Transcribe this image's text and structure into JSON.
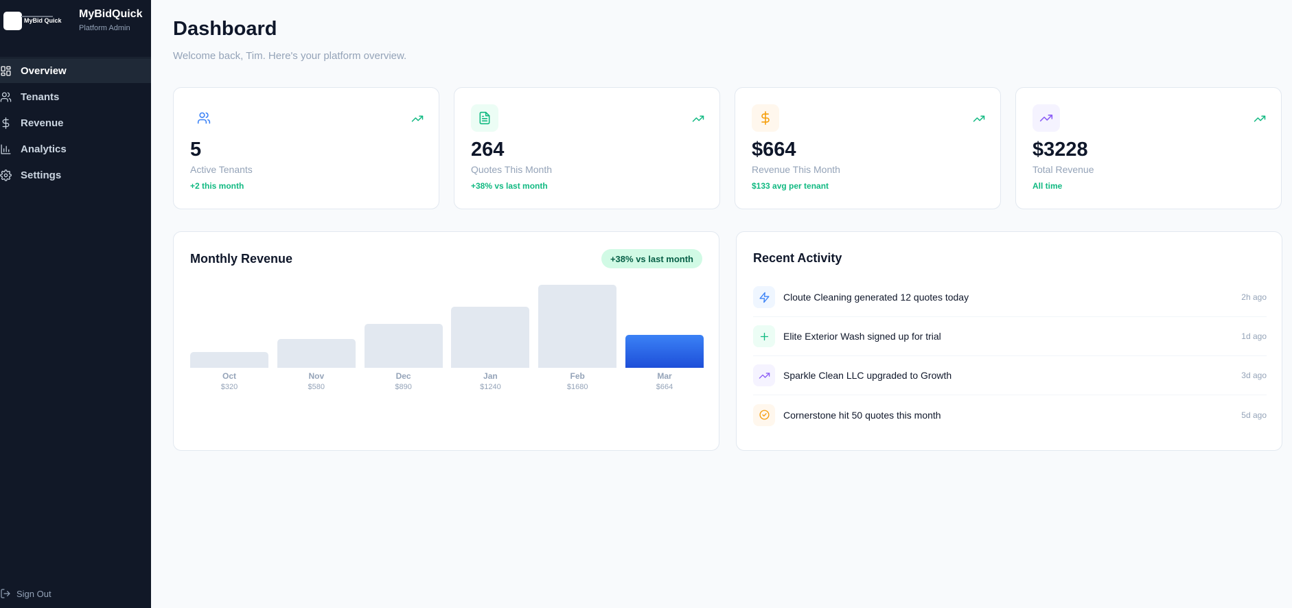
{
  "brand": {
    "logo_text": "MyBid  Quick",
    "name": "MyBidQuick",
    "role": "Platform Admin"
  },
  "nav": {
    "items": [
      {
        "label": "Overview",
        "icon": "grid-icon",
        "active": true
      },
      {
        "label": "Tenants",
        "icon": "users-icon",
        "active": false
      },
      {
        "label": "Revenue",
        "icon": "dollar-icon",
        "active": false
      },
      {
        "label": "Analytics",
        "icon": "bar-chart-icon",
        "active": false
      },
      {
        "label": "Settings",
        "icon": "gear-icon",
        "active": false
      }
    ],
    "sign_out": "Sign Out"
  },
  "header": {
    "title": "Dashboard",
    "subtitle": "Welcome back, Tim. Here's your platform overview."
  },
  "stats": [
    {
      "value": "5",
      "label": "Active Tenants",
      "note": "+2 this month",
      "icon": "users-icon",
      "color": "#3b82f6",
      "bg": "#ffffff"
    },
    {
      "value": "264",
      "label": "Quotes This Month",
      "note": "+38% vs last month",
      "icon": "document-icon",
      "color": "#10b981",
      "bg": "#ecfdf5"
    },
    {
      "value": "$664",
      "label": "Revenue This Month",
      "note": "$133 avg per tenant",
      "icon": "dollar-icon",
      "color": "#f59e0b",
      "bg": "#fff7ed"
    },
    {
      "value": "$3228",
      "label": "Total Revenue",
      "note": "All time",
      "icon": "trending-up-icon",
      "color": "#8b5cf6",
      "bg": "#f5f3ff"
    }
  ],
  "revenue_chart": {
    "title": "Monthly Revenue",
    "badge": "+38% vs last month"
  },
  "chart_data": {
    "type": "bar",
    "title": "Monthly Revenue",
    "categories": [
      "Oct",
      "Nov",
      "Dec",
      "Jan",
      "Feb",
      "Mar"
    ],
    "values": [
      320,
      580,
      890,
      1240,
      1680,
      664
    ],
    "value_labels": [
      "$320",
      "$580",
      "$890",
      "$1240",
      "$1680",
      "$664"
    ],
    "highlight_index": 5,
    "colors": {
      "bar": "#e2e8f0",
      "highlight": "#2563eb"
    },
    "ylim": [
      0,
      1680
    ],
    "grid": false
  },
  "activity": {
    "title": "Recent Activity",
    "items": [
      {
        "text": "Cloute Cleaning generated 12 quotes today",
        "time": "2h ago",
        "icon": "lightning-icon",
        "color": "#3b82f6",
        "bg": "#eff6ff"
      },
      {
        "text": "Elite Exterior Wash signed up for trial",
        "time": "1d ago",
        "icon": "plus-icon",
        "color": "#10b981",
        "bg": "#ecfdf5"
      },
      {
        "text": "Sparkle Clean LLC upgraded to Growth",
        "time": "3d ago",
        "icon": "trending-up-icon",
        "color": "#8b5cf6",
        "bg": "#f5f3ff"
      },
      {
        "text": "Cornerstone hit 50 quotes this month",
        "time": "5d ago",
        "icon": "check-circle-icon",
        "color": "#f59e0b",
        "bg": "#fff7ed"
      }
    ]
  }
}
